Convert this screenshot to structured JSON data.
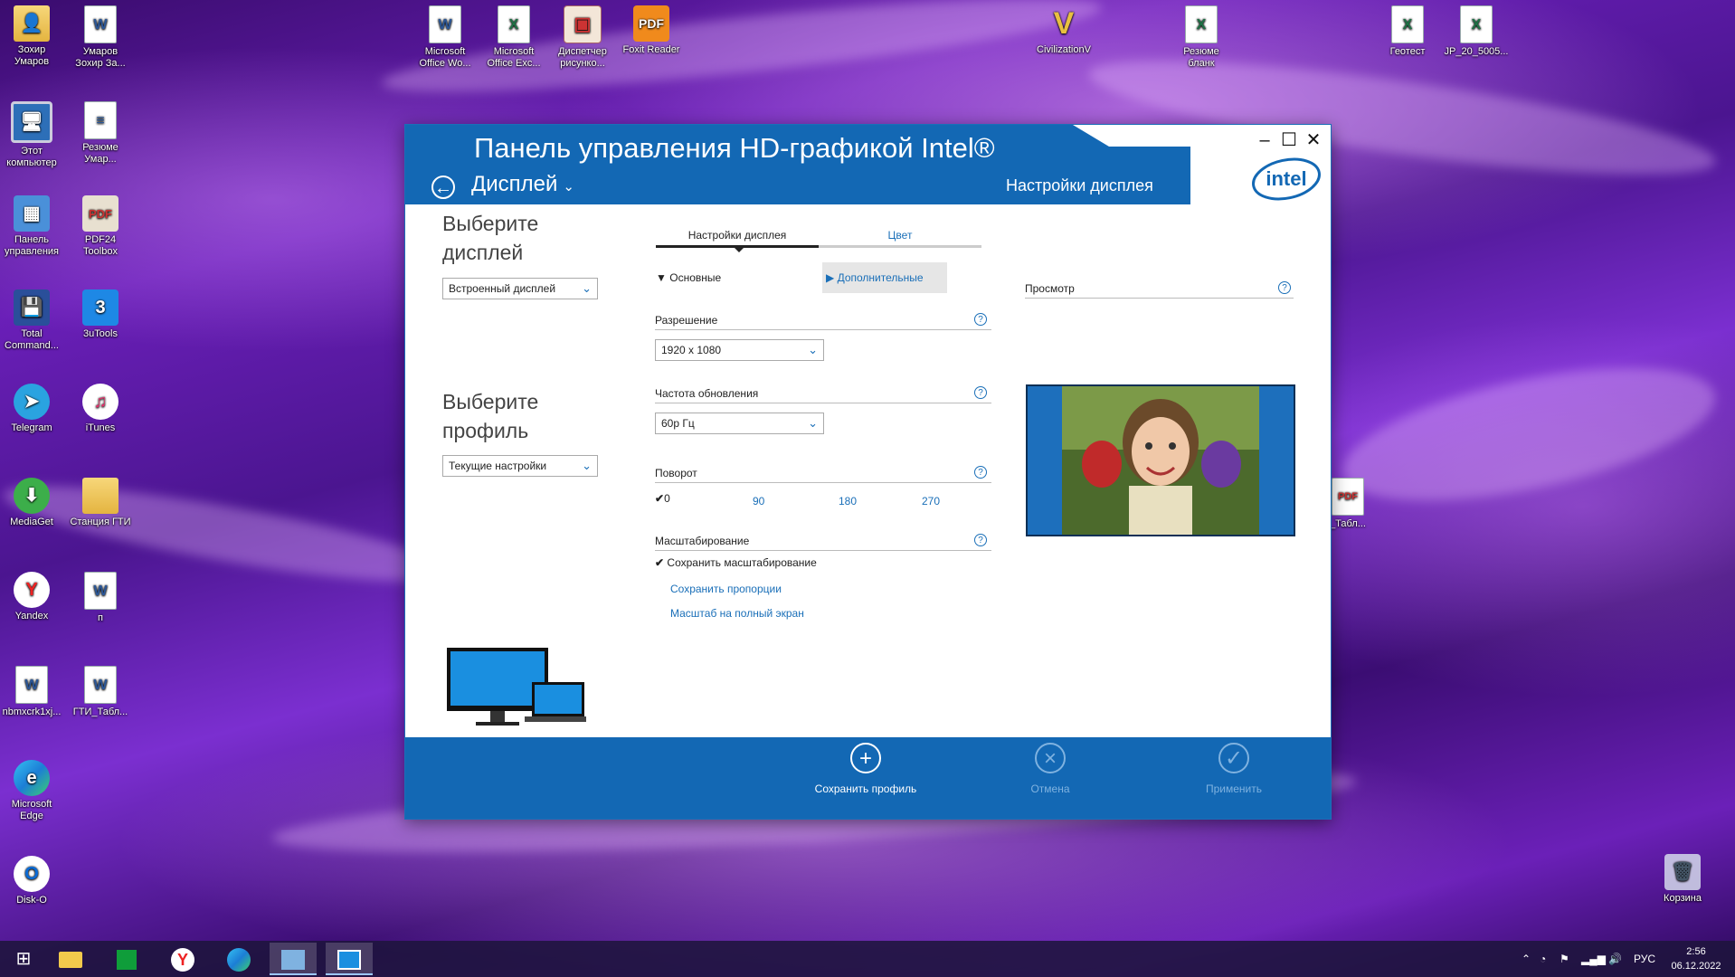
{
  "desktop": {
    "icons": [
      {
        "label": "Зохир\nУмаров"
      },
      {
        "label": "Умаров\nЗохир За..."
      },
      {
        "label": "Этот\nкомпьютер"
      },
      {
        "label": "Резюме\nУмар..."
      },
      {
        "label": "Панель\nуправления"
      },
      {
        "label": "PDF24\nToolbox"
      },
      {
        "label": "Total\nCommand..."
      },
      {
        "label": "3uTools"
      },
      {
        "label": "Telegram"
      },
      {
        "label": "iTunes"
      },
      {
        "label": "MediaGet"
      },
      {
        "label": "Станция ГТИ"
      },
      {
        "label": "Yandex"
      },
      {
        "label": "п"
      },
      {
        "label": "nbmxcrk1xj..."
      },
      {
        "label": "ГТИ_Табл..."
      },
      {
        "label": "Microsoft\nEdge"
      },
      {
        "label": "Disk-O"
      },
      {
        "label": "Microsoft\nOffice Wo..."
      },
      {
        "label": "Microsoft\nOffice Exc..."
      },
      {
        "label": "Диспетчер\nрисунко..."
      },
      {
        "label": "Foxit Reader"
      },
      {
        "label": "CivilizationV"
      },
      {
        "label": "Резюме\nбланк"
      },
      {
        "label": "Геотест"
      },
      {
        "label": "JP_20_5005..."
      },
      {
        "label": "_Табл..."
      },
      {
        "label": "Корзина"
      }
    ]
  },
  "window": {
    "title": "Панель управления HD-графикой Intel®",
    "section": "Дисплей",
    "header_right": "Настройки дисплея",
    "controls": {
      "minimize": "–",
      "maximize": "☐",
      "close": "✕"
    },
    "logo_text": "intel",
    "left": {
      "select_display_label": "Выберите дисплей",
      "display_value": "Встроенный дисплей",
      "select_profile_label": "Выберите профиль",
      "profile_value": "Текущие настройки"
    },
    "tabs": [
      {
        "label": "Настройки дисплея",
        "active": true
      },
      {
        "label": "Цвет",
        "active": false
      }
    ],
    "subtabs": {
      "basic": "Основные",
      "advanced": "Дополнительные"
    },
    "resolution": {
      "label": "Разрешение",
      "value": "1920 x 1080"
    },
    "refresh": {
      "label": "Частота обновления",
      "value": "60p Гц"
    },
    "rotation": {
      "label": "Поворот",
      "options": [
        "0",
        "90",
        "180",
        "270"
      ],
      "selected": "0"
    },
    "scaling": {
      "label": "Масштабирование",
      "options": [
        "Сохранить масштабирование",
        "Сохранить пропорции",
        "Масштаб на полный экран"
      ],
      "selected": "Сохранить масштабирование"
    },
    "preview": {
      "label": "Просмотр"
    },
    "footer": {
      "save_profile": "Сохранить профиль",
      "cancel": "Отмена",
      "apply": "Применить"
    },
    "colors": {
      "header": "#1368b4",
      "accent": "#1a6fb8"
    }
  },
  "taskbar": {
    "lang": "РУС",
    "time": "2:56",
    "date": "06.12.2022"
  }
}
